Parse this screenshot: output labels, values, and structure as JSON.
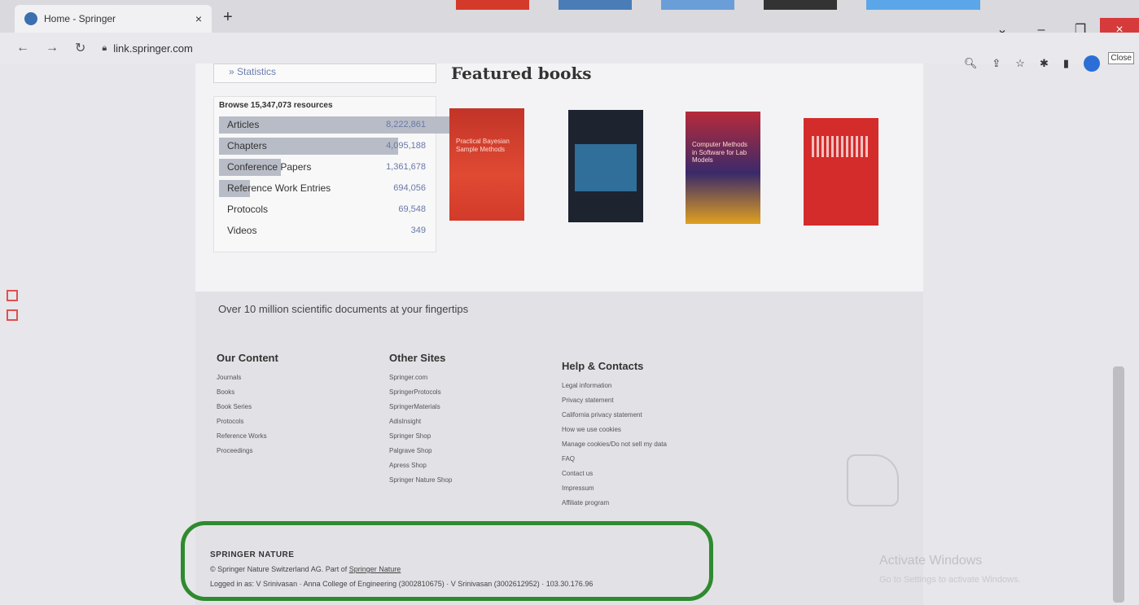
{
  "browser": {
    "tab_title": "Home - Springer",
    "tab_close": "×",
    "new_tab": "+",
    "url": "link.springer.com",
    "close_tooltip": "Close",
    "min_label": "–",
    "restore_label": "❐",
    "close_label": "×"
  },
  "sidebar": {
    "statistics_link": "» Statistics"
  },
  "featured": {
    "heading": "Featured books",
    "books": [
      {
        "title": "Practical Bayesian Sample Methods"
      },
      {
        "title": ""
      },
      {
        "title": "Computer Methods in Software for Lab Models"
      },
      {
        "title": ""
      }
    ]
  },
  "browse": {
    "title": "Browse 15,347,073 resources",
    "resources": [
      {
        "label": "Articles",
        "count": "8,222,861",
        "fraction": 0.47
      },
      {
        "label": "Chapters",
        "count": "4,095,188",
        "fraction": 0.29
      },
      {
        "label": "Conference Papers",
        "count": "1,361,678",
        "fraction": 0.1
      },
      {
        "label": "Reference Work Entries",
        "count": "694,056",
        "fraction": 0.05
      },
      {
        "label": "Protocols",
        "count": "69,548",
        "fraction": 0.0
      },
      {
        "label": "Videos",
        "count": "349",
        "fraction": 0.0
      }
    ]
  },
  "footer": {
    "tagline": "Over 10 million scientific documents at your fingertips",
    "our_content": {
      "heading": "Our Content",
      "links": [
        "Journals",
        "Books",
        "Book Series",
        "Protocols",
        "Reference Works",
        "Proceedings"
      ]
    },
    "other_sites": {
      "heading": "Other Sites",
      "links": [
        "Springer.com",
        "SpringerProtocols",
        "SpringerMaterials",
        "AdisInsight",
        "Springer Shop",
        "Palgrave Shop",
        "Apress Shop",
        "Springer Nature Shop"
      ]
    },
    "help": {
      "heading": "Help & Contacts",
      "links": [
        "Legal information",
        "Privacy statement",
        "California privacy statement",
        "How we use cookies",
        "Manage cookies/Do not sell my data",
        "FAQ",
        "Contact us",
        "Impressum",
        "Affiliate program"
      ]
    },
    "brand": "SPRINGER NATURE",
    "copyright_prefix": "© Springer Nature Switzerland AG. Part of",
    "copyright_link": "Springer Nature",
    "logged_in": "Logged in as: V Srinivasan · Anna College of Engineering (3002810675) · V Srinivasan (3002612952) · 103.30.176.96"
  },
  "watermark": {
    "title": "Activate Windows",
    "subtitle": "Go to Settings to activate Windows."
  }
}
